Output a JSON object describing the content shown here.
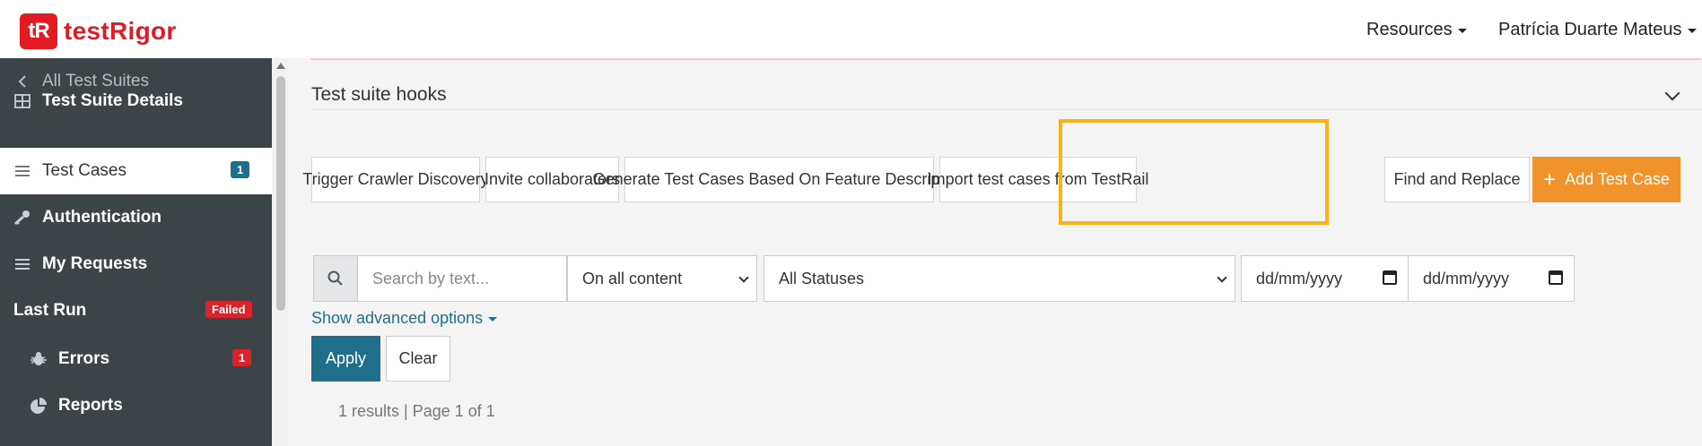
{
  "logo": {
    "badge": "tR",
    "name": "testRigor"
  },
  "topnav": {
    "resources": "Resources",
    "user": "Patrícia Duarte Mateus"
  },
  "sidebar": {
    "back": "All Test Suites",
    "items": [
      {
        "label": "Test Suite Details",
        "icon": "grid-icon"
      },
      {
        "label": "Test Cases",
        "icon": "list-icon",
        "badge": "1"
      },
      {
        "label": "Authentication",
        "icon": "key-icon"
      },
      {
        "label": "My Requests",
        "icon": "list-icon"
      }
    ],
    "last_run": {
      "label": "Last Run",
      "badge": "Failed"
    },
    "sub_items": [
      {
        "label": "Errors",
        "icon": "bug-icon",
        "badge": "1"
      },
      {
        "label": "Reports",
        "icon": "pie-chart-icon"
      }
    ]
  },
  "main": {
    "hooks_title": "Test suite hooks",
    "buttons": {
      "crawler": "Trigger Crawler Discovery",
      "invite": "Invite collaborators",
      "generate": "Generate Test Cases Based On Feature Description",
      "import": "Import test cases from TestRail",
      "find_replace": "Find and Replace",
      "add": "Add Test Case"
    },
    "filters": {
      "search_placeholder": "Search by text...",
      "content": "On all content",
      "status": "All Statuses",
      "date_from": "dd/mm/yyyy",
      "date_to": "dd/mm/yyyy"
    },
    "advanced": "Show advanced options",
    "apply": "Apply",
    "clear": "Clear",
    "results": "1 results | Page 1 of 1"
  },
  "colors": {
    "brand": "#e21b23",
    "sidebar": "#3d4448",
    "primary": "#1f6f8b",
    "orange": "#f0932b",
    "highlight": "#f8b21a",
    "badge_blue": "#1f6f8b",
    "badge_red": "#d9232d"
  }
}
